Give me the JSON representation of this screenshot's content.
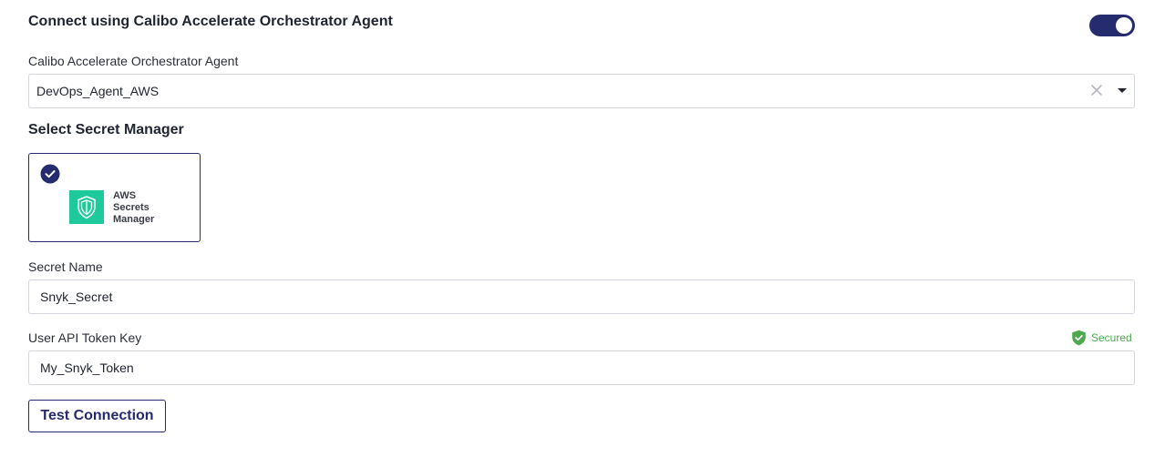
{
  "agent_section": {
    "title": "Connect using Calibo Accelerate Orchestrator Agent",
    "toggle_on": true,
    "agent_label": "Calibo Accelerate Orchestrator Agent",
    "agent_value": "DevOps_Agent_AWS",
    "clear_icon": "close-icon",
    "dropdown_icon": "caret-down-icon"
  },
  "secret_manager": {
    "title": "Select Secret Manager",
    "selected": true,
    "options": [
      {
        "name_lines": [
          "AWS",
          "Secrets",
          "Manager"
        ],
        "logo_color": "#1ec99b",
        "icon": "shield-icon"
      }
    ]
  },
  "secret_name": {
    "label": "Secret Name",
    "value": "Snyk_Secret"
  },
  "api_token": {
    "label": "User API Token Key",
    "value": "My_Snyk_Token",
    "secured_label": "Secured"
  },
  "actions": {
    "test_connection_label": "Test Connection"
  },
  "colors": {
    "primary": "#262a6e",
    "secured": "#4ca94f",
    "border": "#d3d6dc"
  }
}
